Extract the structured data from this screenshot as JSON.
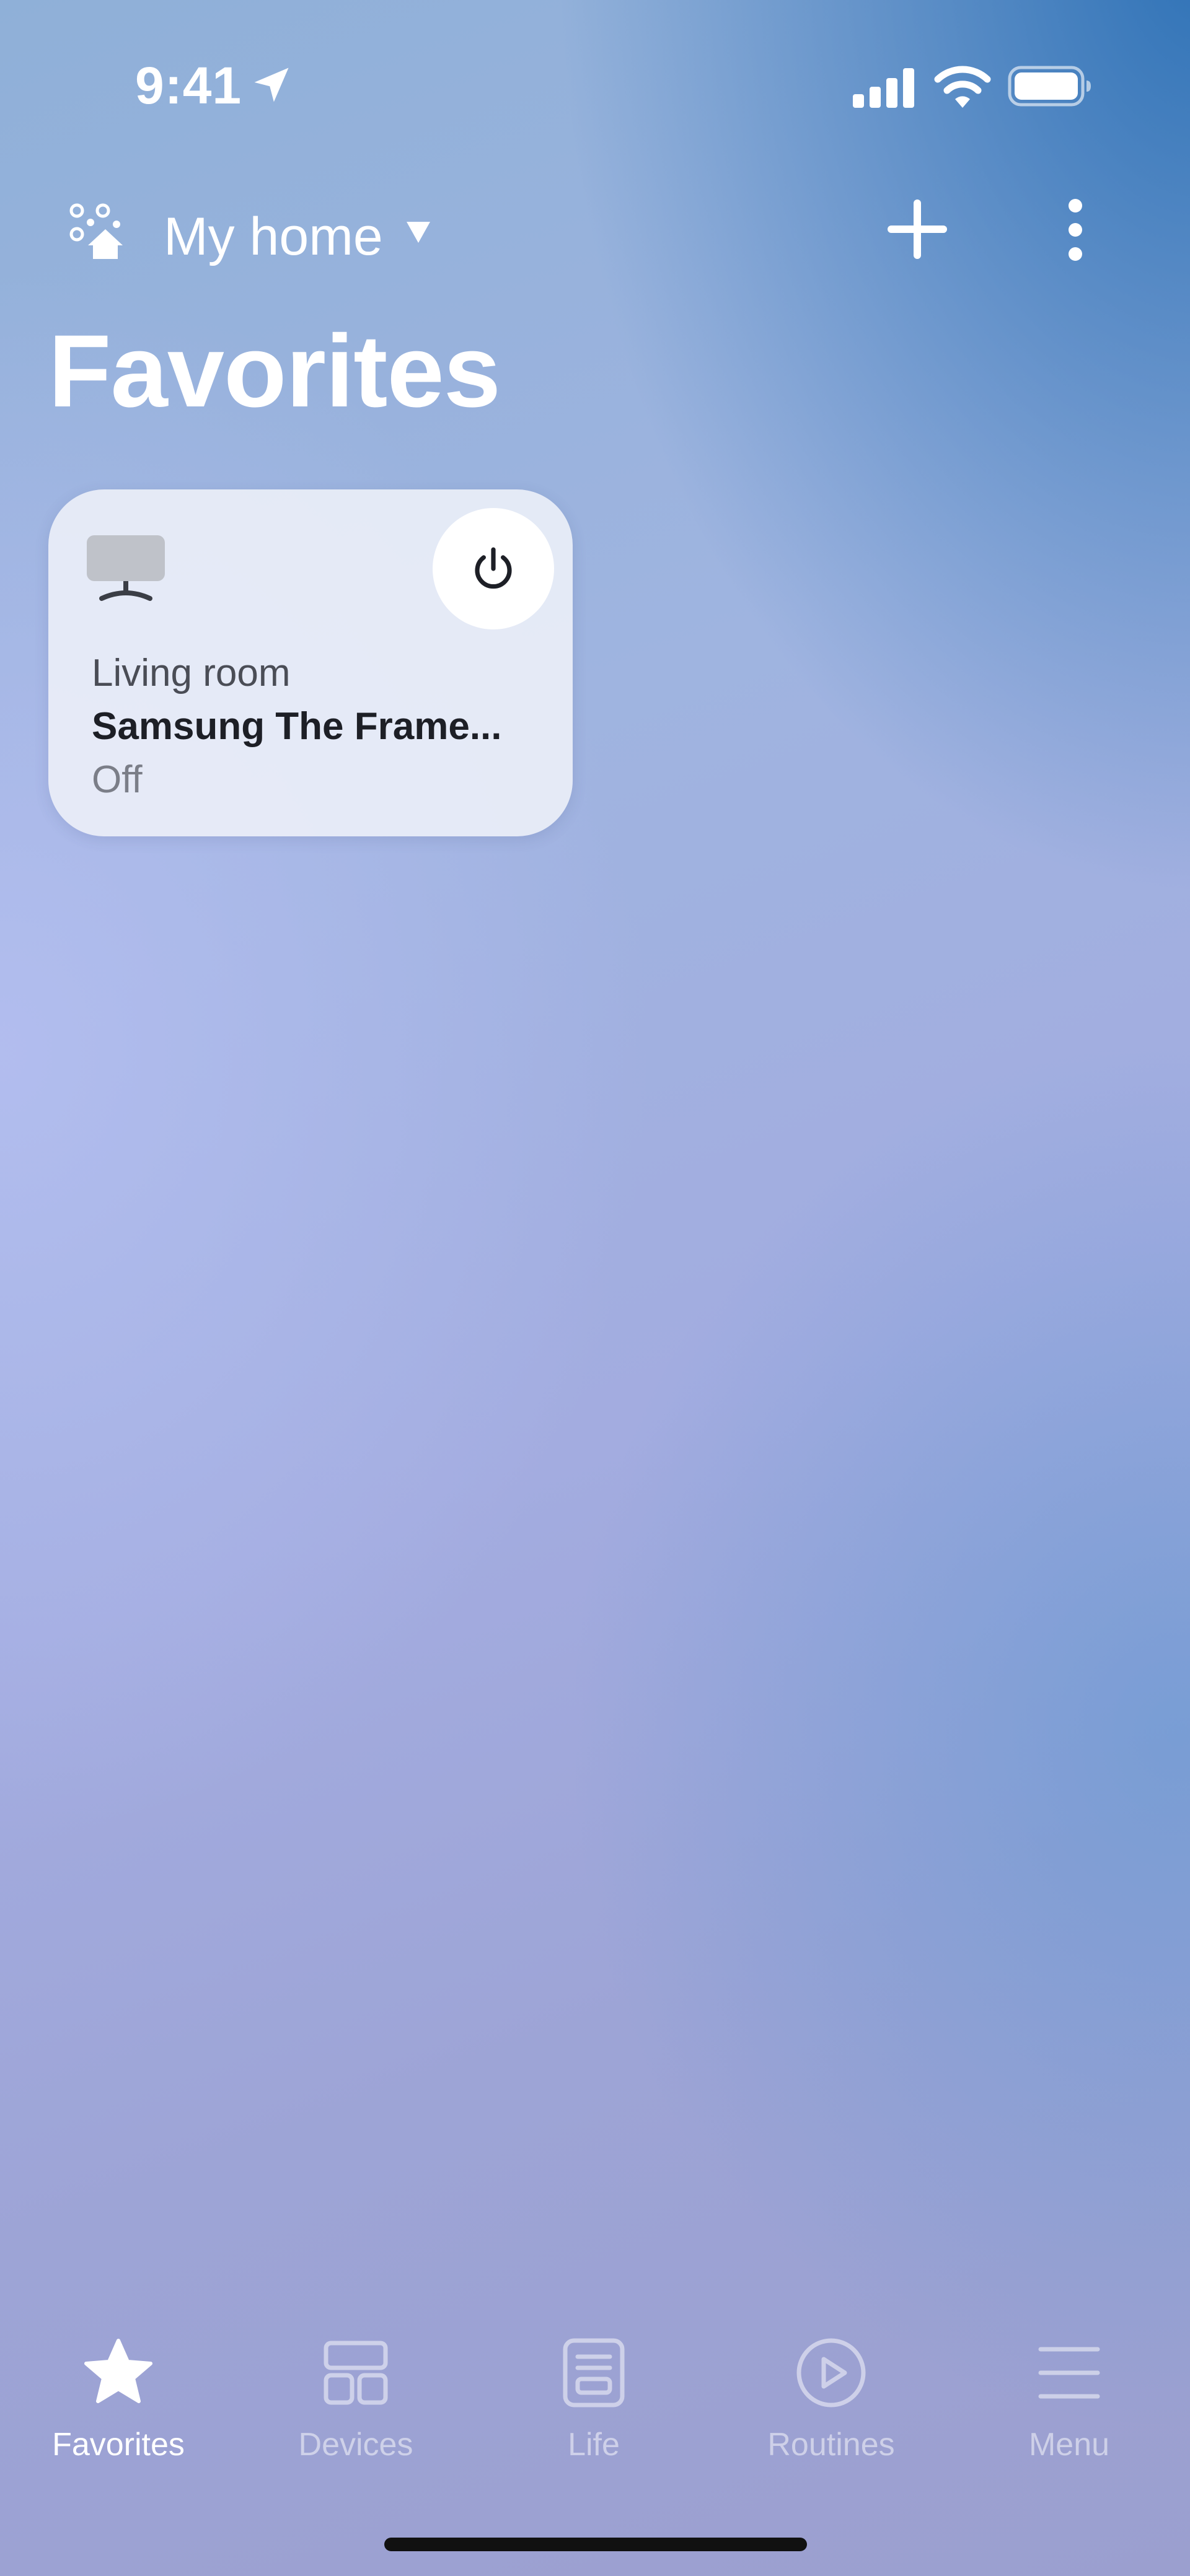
{
  "status_bar": {
    "time": "9:41"
  },
  "header": {
    "home_name": "My home",
    "page_title": "Favorites"
  },
  "favorites": [
    {
      "room": "Living room",
      "name": "Samsung The Frame...",
      "state": "Off"
    }
  ],
  "bottom_nav": {
    "items": [
      {
        "label": "Favorites",
        "icon": "star-icon",
        "active": true
      },
      {
        "label": "Devices",
        "icon": "devices-grid-icon",
        "active": false
      },
      {
        "label": "Life",
        "icon": "life-card-icon",
        "active": false
      },
      {
        "label": "Routines",
        "icon": "play-circle-icon",
        "active": false
      },
      {
        "label": "Menu",
        "icon": "hamburger-menu-icon",
        "active": false
      }
    ]
  },
  "colors": {
    "card_background": "#eceff8",
    "power_icon": "#1d1f26",
    "nav_active": "#ffffff",
    "nav_inactive": "#ffffff80"
  }
}
